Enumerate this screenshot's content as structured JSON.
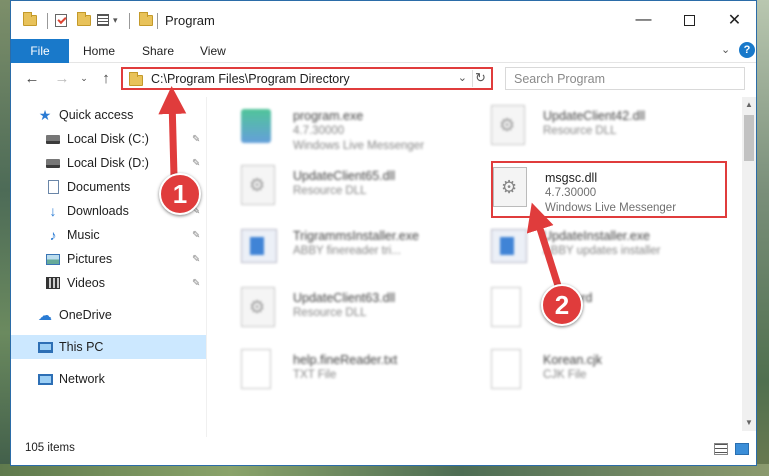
{
  "window": {
    "title": "Program"
  },
  "ribbon": {
    "file": "File",
    "home": "Home",
    "share": "Share",
    "view": "View",
    "help": "?"
  },
  "address": {
    "path": "C:\\Program Files\\Program Directory"
  },
  "search": {
    "placeholder": "Search Program"
  },
  "sidebar": {
    "items": [
      {
        "label": "Quick access",
        "icon": "star-icon"
      },
      {
        "label": "Local Disk (C:)",
        "icon": "drive-icon"
      },
      {
        "label": "Local Disk (D:)",
        "icon": "drive-icon"
      },
      {
        "label": "Documents",
        "icon": "documents-icon"
      },
      {
        "label": "Downloads",
        "icon": "downloads-icon"
      },
      {
        "label": "Music",
        "icon": "music-icon"
      },
      {
        "label": "Pictures",
        "icon": "pictures-icon"
      },
      {
        "label": "Videos",
        "icon": "videos-icon"
      },
      {
        "label": "OneDrive",
        "icon": "cloud-icon"
      },
      {
        "label": "This PC",
        "icon": "computer-icon"
      },
      {
        "label": "Network",
        "icon": "network-icon"
      }
    ]
  },
  "files": [
    {
      "name": "program.exe",
      "line2": "4.7.30000",
      "line3": "Windows Live Messenger"
    },
    {
      "name": "UpdateClient42.dll",
      "line2": "Resource DLL",
      "line3": ""
    },
    {
      "name": "UpdateClient65.dll",
      "line2": "Resource DLL",
      "line3": ""
    },
    {
      "name": "msgsc.dll",
      "line2": "4.7.30000",
      "line3": "Windows Live Messenger"
    },
    {
      "name": "TrigrammsInstaller.exe",
      "line2": "ABBY finereader tri...",
      "line3": ""
    },
    {
      "name": "UpdateInstaller.exe",
      "line2": "ABBY updates installer",
      "line3": ""
    },
    {
      "name": "UpdateClient63.dll",
      "line2": "Resource DLL",
      "line3": ""
    },
    {
      "name": "Anaword",
      "line2": "",
      "line3": ""
    },
    {
      "name": "help.fineReader.txt",
      "line2": "TXT File",
      "line3": ""
    },
    {
      "name": "Korean.cjk",
      "line2": "CJK File",
      "line3": ""
    }
  ],
  "status": {
    "count": "105 items"
  },
  "annotations": {
    "badge1": "1",
    "badge2": "2"
  },
  "colors": {
    "accent": "#1979ca",
    "annotation": "#e03c3c",
    "selected": "#cce8ff"
  }
}
